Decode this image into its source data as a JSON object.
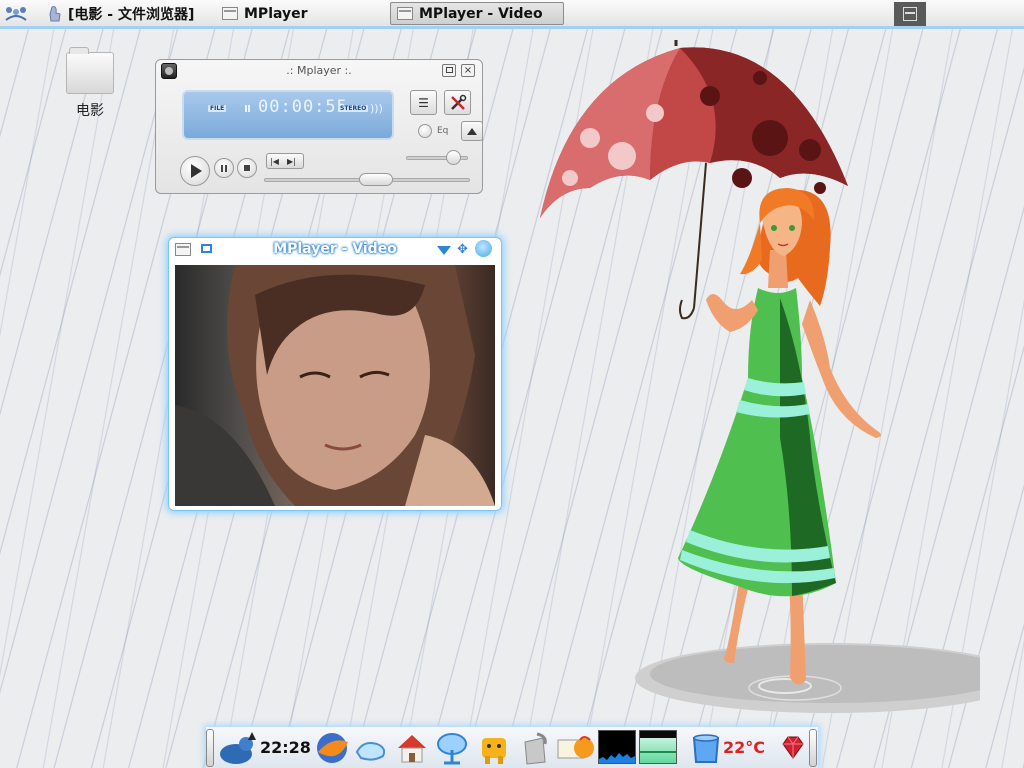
{
  "taskbar": {
    "items": [
      {
        "label": "[电影 - 文件浏览器]",
        "active": false
      },
      {
        "label": "MPlayer",
        "active": false
      },
      {
        "label": "MPlayer - Video",
        "active": true
      }
    ]
  },
  "desktop": {
    "icons": [
      {
        "label": "电影",
        "icon": "folder-icon"
      }
    ]
  },
  "mplayer": {
    "title": ".: Mplayer :.",
    "display": {
      "file_tag": "FILE",
      "stereo_tag": "STEREO",
      "time": "00:00:55"
    },
    "eq_label": "Eq",
    "volume_level": 0.85,
    "seek_position": 0.55
  },
  "video_window": {
    "title": "MPlayer - Video"
  },
  "dock": {
    "clock": "22:28",
    "temperature": "22°C",
    "icons": [
      "maximus-icon",
      "browser-icon",
      "network-icon",
      "home-icon",
      "satellite-icon",
      "mascot-icon",
      "trash-icon",
      "notes-icon",
      "cpu-graph",
      "mem-graph",
      "water-icon",
      "ruby-icon"
    ]
  },
  "colors": {
    "accent": "#9fd0f6",
    "temperature": "#e02020",
    "dock_glow": "#a9d8ff"
  }
}
